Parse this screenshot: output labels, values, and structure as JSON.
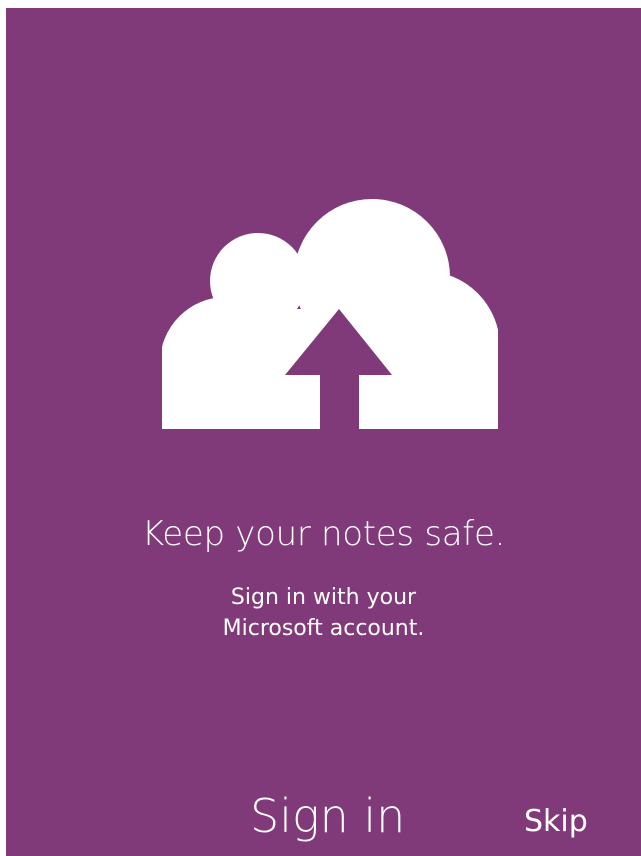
{
  "colors": {
    "background": "#813a79",
    "foreground": "#ffffff"
  },
  "hero": {
    "icon": "cloud-upload-icon",
    "title": "Keep your notes safe.",
    "subtitle_line1": "Sign in with your",
    "subtitle_line2": "Microsoft account."
  },
  "actions": {
    "sign_in_label": "Sign in",
    "skip_label": "Skip"
  }
}
